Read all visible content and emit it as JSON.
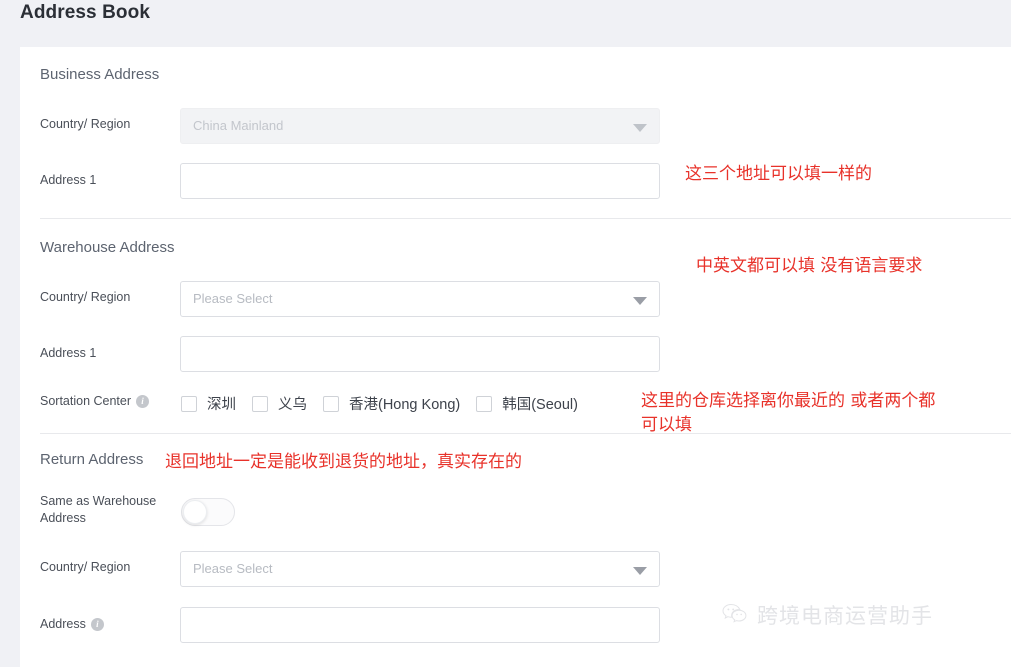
{
  "header": {
    "title": "Address Book"
  },
  "sections": {
    "business": {
      "title": "Business Address",
      "country_label": "Country/ Region",
      "country_value": "China Mainland",
      "address1_label": "Address 1",
      "address1_value": ""
    },
    "warehouse": {
      "title": "Warehouse Address",
      "country_label": "Country/ Region",
      "country_placeholder": "Please Select",
      "address1_label": "Address 1",
      "address1_value": "",
      "sortation_label": "Sortation Center",
      "sortation_options": [
        {
          "label": "深圳",
          "checked": false
        },
        {
          "label": "义乌",
          "checked": false
        },
        {
          "label": "香港(Hong Kong)",
          "checked": false
        },
        {
          "label": "韩国(Seoul)",
          "checked": false
        }
      ]
    },
    "return": {
      "title": "Return Address",
      "same_as_warehouse_label": "Same as Warehouse Address",
      "same_as_warehouse_on": false,
      "country_label": "Country/ Region",
      "country_placeholder": "Please Select",
      "address_label": "Address",
      "address_value": ""
    }
  },
  "annotations": [
    {
      "text": "这三个地址可以填一样的"
    },
    {
      "text": "中英文都可以填 没有语言要求"
    },
    {
      "text": "这里的仓库选择离你最近的 或者两个都\n可以填"
    },
    {
      "text": "退回地址一定是能收到退货的地址，真实存在的"
    }
  ],
  "watermark": {
    "icon": "wechat-icon",
    "text": "跨境电商运营助手"
  },
  "icons": {
    "info": "i",
    "caret_down": "chevron-down-icon",
    "wechat": "💬"
  },
  "colors": {
    "annotation_red": "#e8322a",
    "page_background": "#f0f1f5",
    "card_background": "#ffffff",
    "text_primary": "#4a4f58",
    "placeholder": "#b7bbc2"
  }
}
